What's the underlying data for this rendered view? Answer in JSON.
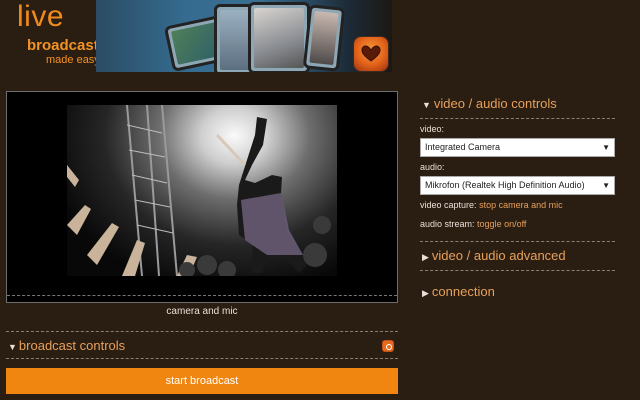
{
  "brand": {
    "line1": "live",
    "line2": "broadcasting",
    "line3": "made easy"
  },
  "preview": {
    "caption": "camera and mic"
  },
  "broadcast": {
    "header": "broadcast controls",
    "start_label": "start broadcast"
  },
  "controls": {
    "header": "video / audio controls",
    "video_label": "video:",
    "video_value": "Integrated Camera",
    "audio_label": "audio:",
    "audio_value": "Mikrofon (Realtek High Definition Audio)",
    "video_capture_label": "video capture:",
    "video_capture_link": "stop camera and mic",
    "audio_stream_label": "audio stream:",
    "audio_stream_link": "toggle on/off"
  },
  "advanced": {
    "header": "video / audio advanced"
  },
  "connection": {
    "header": "connection"
  },
  "colors": {
    "background": "#2a1d12",
    "accent": "#f0860f",
    "link": "#e8a05a"
  },
  "icons": {
    "expanded": "triangle-down",
    "collapsed": "triangle-right"
  }
}
